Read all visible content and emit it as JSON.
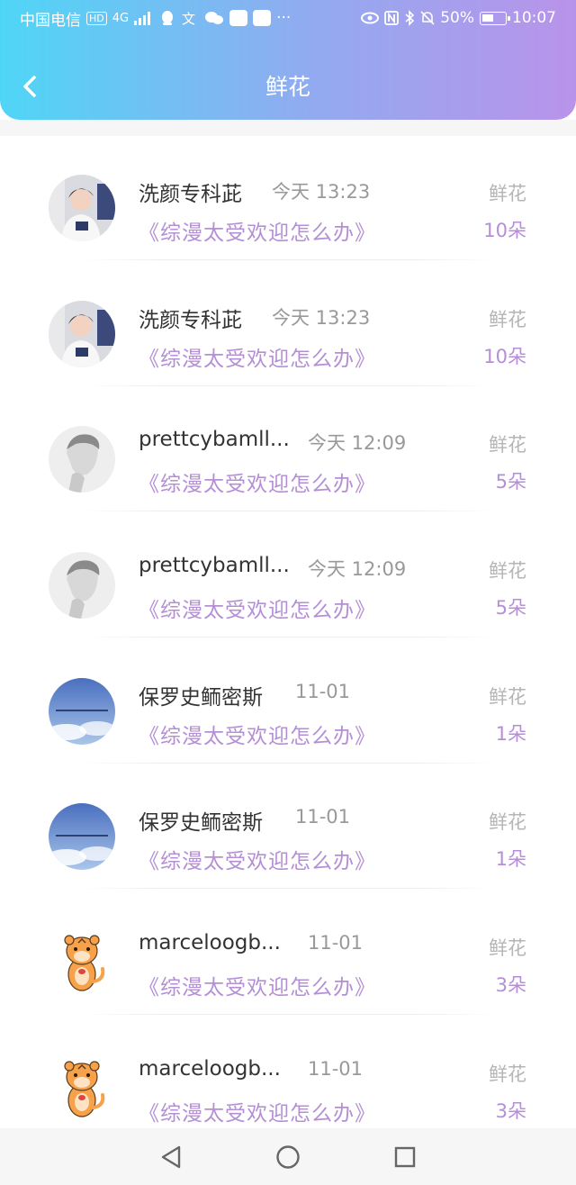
{
  "status_bar": {
    "carrier": "中国电信",
    "hd_badge": "HD",
    "network": "4G",
    "battery": "50%",
    "battery_level": 0.5,
    "time": "10:07",
    "more": "···"
  },
  "header": {
    "title": "鲜花",
    "back_icon": "chevron-left-icon"
  },
  "items": [
    {
      "name": "洗颜专科茈",
      "time": "今天 13:23",
      "book": "《综漫太受欢迎怎么办》",
      "label": "鲜花",
      "count": "10朵",
      "avatar": "photo-boy"
    },
    {
      "name": "洗颜专科茈",
      "time": "今天 13:23",
      "book": "《综漫太受欢迎怎么办》",
      "label": "鲜花",
      "count": "10朵",
      "avatar": "photo-boy"
    },
    {
      "name": "prettcybamll...",
      "time": "今天 12:09",
      "book": "《综漫太受欢迎怎么办》",
      "label": "鲜花",
      "count": "5朵",
      "avatar": "photo-grey"
    },
    {
      "name": "prettcybamll...",
      "time": "今天 12:09",
      "book": "《综漫太受欢迎怎么办》",
      "label": "鲜花",
      "count": "5朵",
      "avatar": "photo-grey"
    },
    {
      "name": "保罗史鲕密斯",
      "time": "11-01",
      "book": "《综漫太受欢迎怎么办》",
      "label": "鲜花",
      "count": "1朵",
      "avatar": "photo-sky"
    },
    {
      "name": "保罗史鲕密斯",
      "time": "11-01",
      "book": "《综漫太受欢迎怎么办》",
      "label": "鲜花",
      "count": "1朵",
      "avatar": "photo-sky"
    },
    {
      "name": "marceloogb...",
      "time": "11-01",
      "book": "《综漫太受欢迎怎么办》",
      "label": "鲜花",
      "count": "3朵",
      "avatar": "tiger-cartoon"
    },
    {
      "name": "marceloogb...",
      "time": "11-01",
      "book": "《综漫太受欢迎怎么办》",
      "label": "鲜花",
      "count": "3朵",
      "avatar": "tiger-cartoon"
    }
  ],
  "nav": {
    "back": "triangle-back-icon",
    "home": "circle-home-icon",
    "recents": "square-recents-icon"
  },
  "colors": {
    "header_gradient": [
      "#4fd6f6",
      "#93aaf0",
      "#b993ea"
    ],
    "accent": "#b48fd6",
    "muted": "#999999"
  }
}
